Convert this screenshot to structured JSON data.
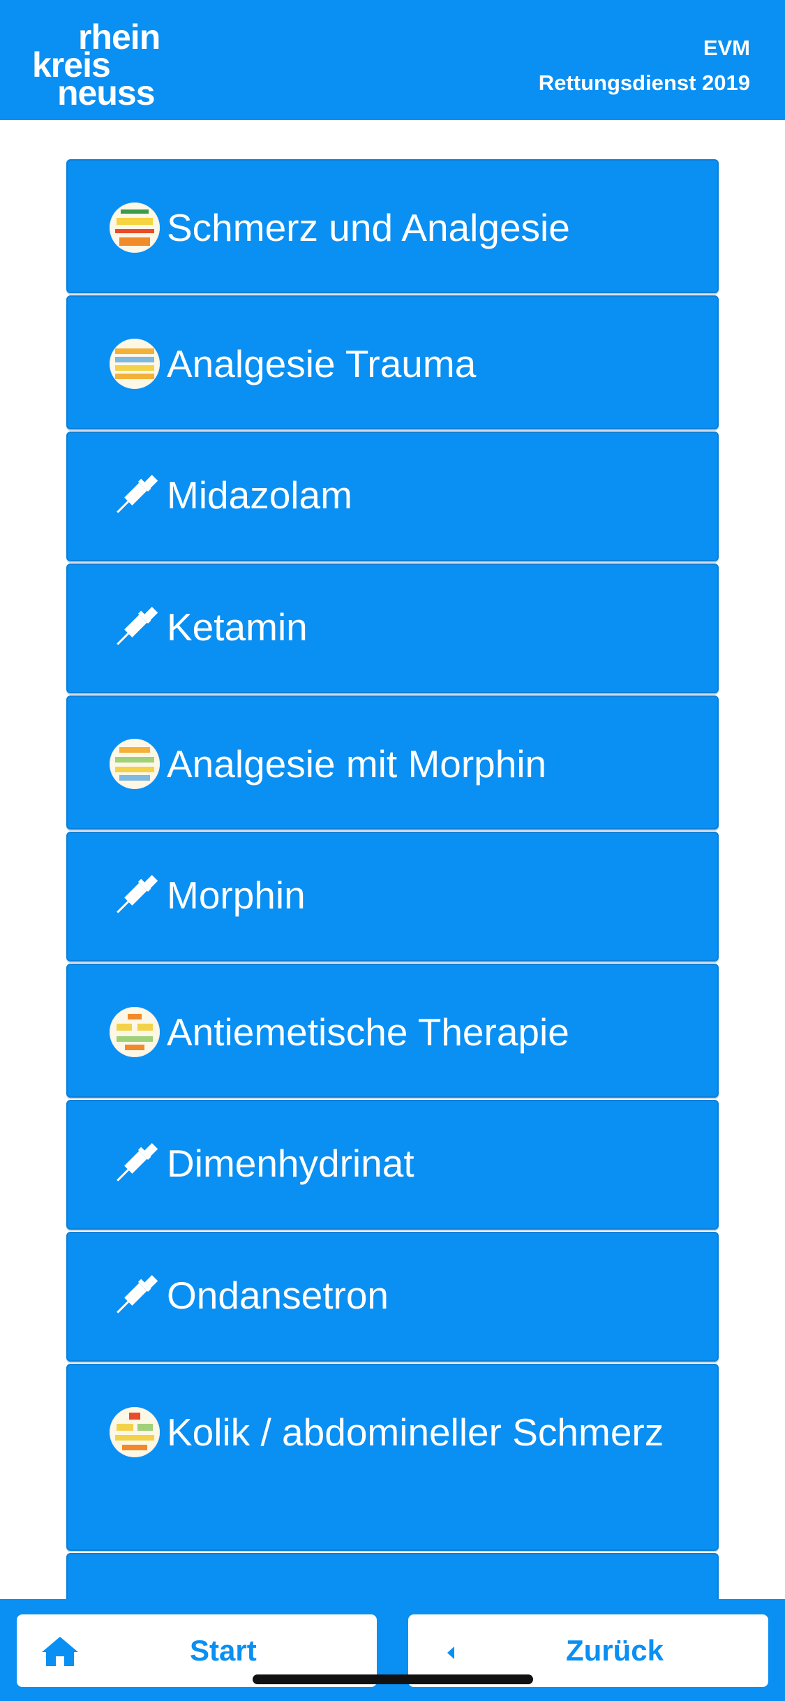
{
  "header": {
    "logo": [
      "rhein",
      "kreis",
      "neuss"
    ],
    "title_line1": "EVM",
    "title_line2": "Rettungsdienst 2019"
  },
  "colors": {
    "primary": "#0a8ff3",
    "button_bg": "#ffffff"
  },
  "items": [
    {
      "label": "Schmerz und Analgesie",
      "icon": "flowchart-thumbnail-icon"
    },
    {
      "label": "Analgesie Trauma",
      "icon": "flowchart-thumbnail-icon"
    },
    {
      "label": "Midazolam",
      "icon": "syringe-icon"
    },
    {
      "label": "Ketamin",
      "icon": "syringe-icon"
    },
    {
      "label": "Analgesie mit Morphin",
      "icon": "flowchart-thumbnail-icon"
    },
    {
      "label": "Morphin",
      "icon": "syringe-icon"
    },
    {
      "label": "Antiemetische Therapie",
      "icon": "flowchart-thumbnail-icon"
    },
    {
      "label": "Dimenhydrinat",
      "icon": "syringe-icon"
    },
    {
      "label": "Ondansetron",
      "icon": "syringe-icon"
    },
    {
      "label": "Kolik / abdomineller Schmerz",
      "icon": "flowchart-thumbnail-icon"
    }
  ],
  "bottom": {
    "start_label": "Start",
    "back_label": "Zurück"
  }
}
